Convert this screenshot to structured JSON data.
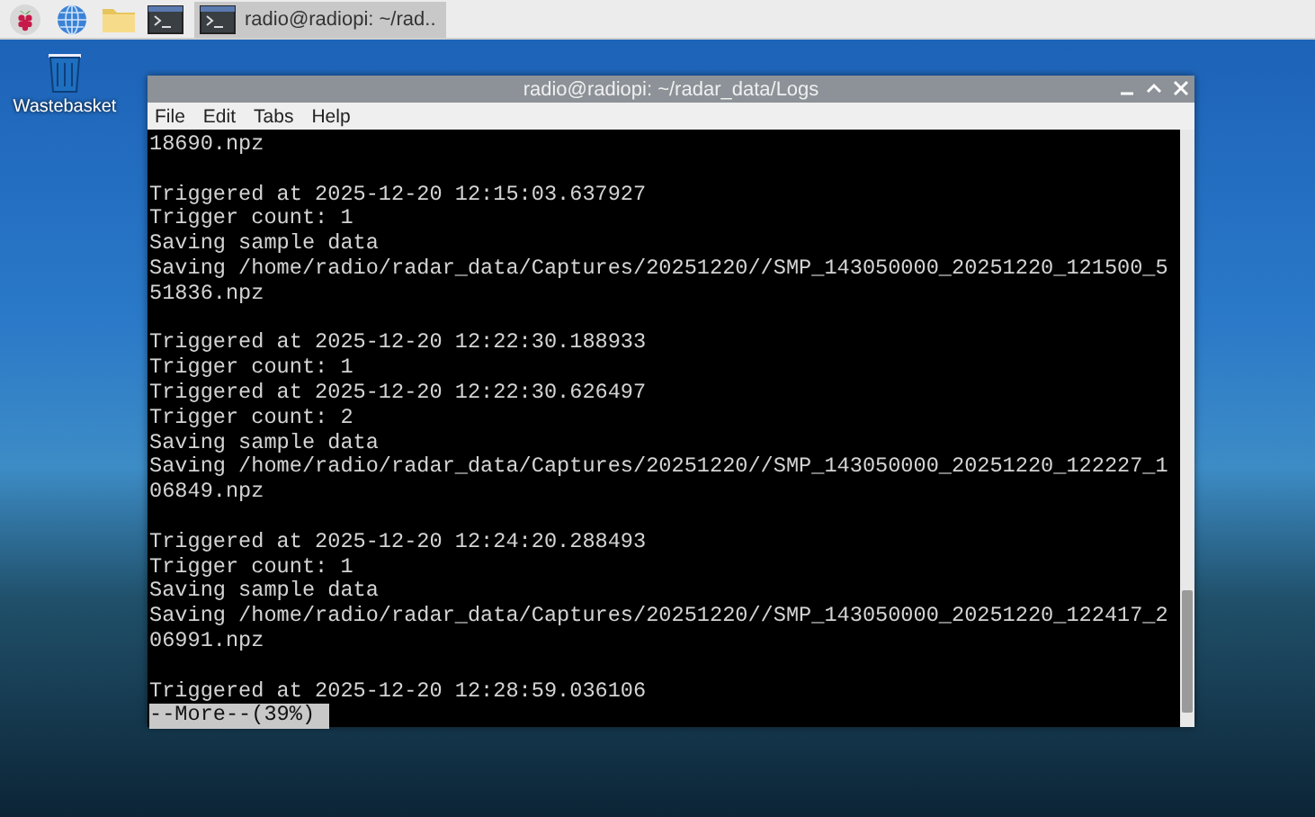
{
  "taskbar": {
    "launchers": [
      {
        "kind": "raspberry"
      },
      {
        "kind": "browser"
      },
      {
        "kind": "files"
      },
      {
        "kind": "terminal"
      }
    ],
    "tasks": [
      {
        "title": "radio@radiopi: ~/rad..",
        "selected": true
      }
    ]
  },
  "desktop": {
    "icons": [
      {
        "label": "Wastebasket"
      }
    ]
  },
  "window": {
    "title": "radio@radiopi: ~/radar_data/Logs",
    "menu": [
      "File",
      "Edit",
      "Tabs",
      "Help"
    ],
    "terminal": {
      "blocks": [
        [
          "18690.npz"
        ],
        [
          "Triggered at 2025-12-20 12:15:03.637927",
          "Trigger count: 1",
          "Saving sample data",
          "Saving /home/radio/radar_data/Captures/20251220//SMP_143050000_20251220_121500_5",
          "51836.npz"
        ],
        [
          "Triggered at 2025-12-20 12:22:30.188933",
          "Trigger count: 1",
          "Triggered at 2025-12-20 12:22:30.626497",
          "Trigger count: 2",
          "Saving sample data",
          "Saving /home/radio/radar_data/Captures/20251220//SMP_143050000_20251220_122227_1",
          "06849.npz"
        ],
        [
          "Triggered at 2025-12-20 12:24:20.288493",
          "Trigger count: 1",
          "Saving sample data",
          "Saving /home/radio/radar_data/Captures/20251220//SMP_143050000_20251220_122417_2",
          "06991.npz"
        ],
        [
          "Triggered at 2025-12-20 12:28:59.036106"
        ]
      ],
      "pager_prompt": "--More--(39%)"
    }
  }
}
